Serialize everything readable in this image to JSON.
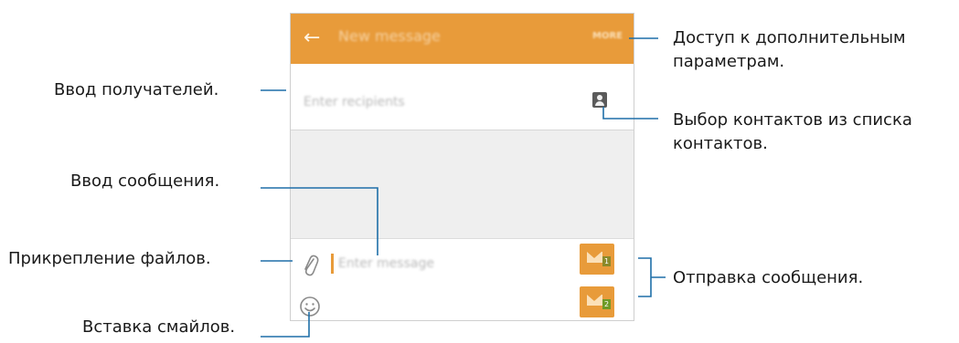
{
  "phone": {
    "title": "New message",
    "more_label": "MORE",
    "recipients_placeholder": "Enter recipients",
    "message_placeholder": "Enter message",
    "send_buttons": [
      {
        "sim": "1"
      },
      {
        "sim": "2"
      }
    ]
  },
  "callouts": {
    "more_options": [
      "Доступ к дополнительным",
      "параметрам."
    ],
    "contacts": [
      "Выбор контактов из списка",
      "контактов."
    ],
    "recipients": "Ввод получателей.",
    "message": "Ввод сообщения.",
    "attach": "Прикрепление файлов.",
    "send": "Отправка сообщения.",
    "smileys": "Вставка смайлов."
  },
  "colors": {
    "accent": "#e89b3a",
    "callout_line": "#1f6fa8"
  }
}
